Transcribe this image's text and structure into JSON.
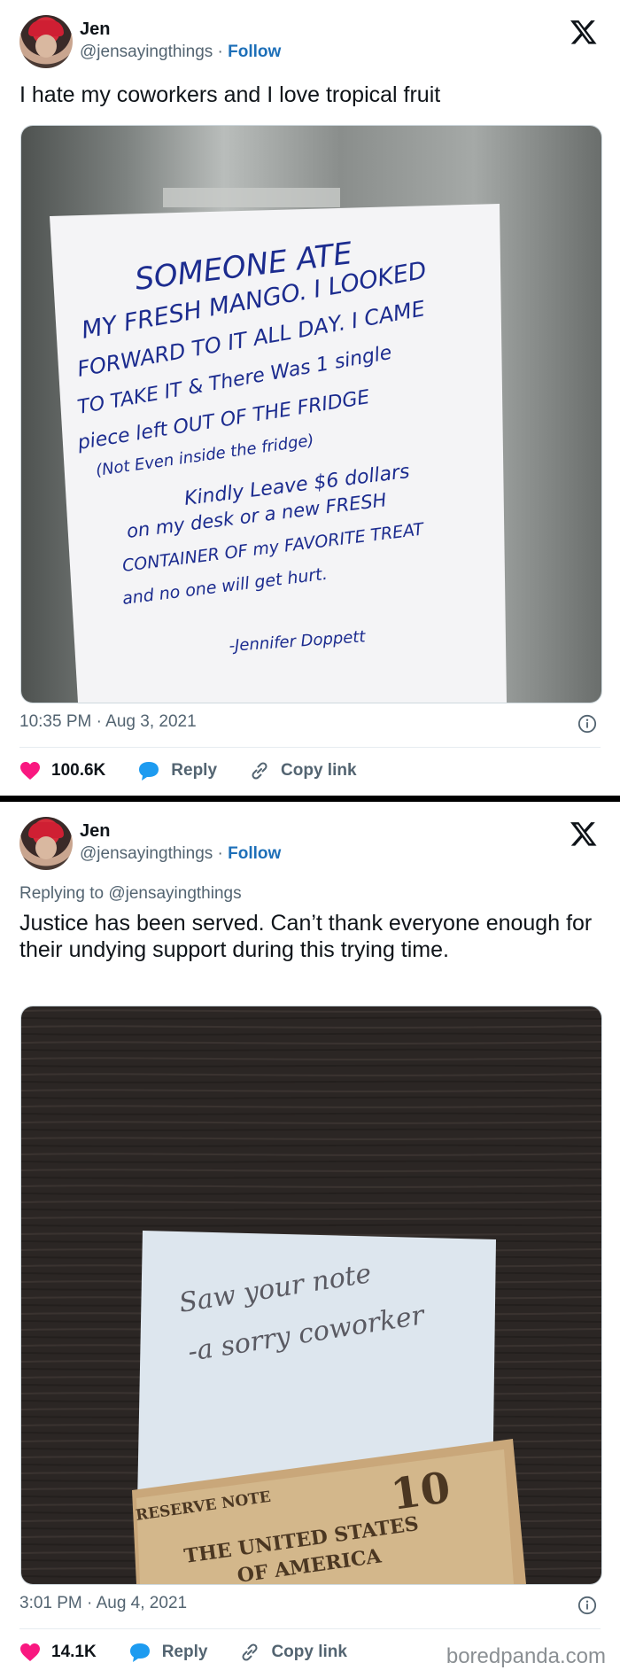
{
  "tweets": [
    {
      "author_name": "Jen",
      "author_handle": "@jensayingthings",
      "separator": "·",
      "follow_label": "Follow",
      "text": "I hate my coworkers and I love tropical fruit",
      "note_lines": [
        "SOMEONE ATE",
        "MY FRESH MANGO. I LOOKED",
        "FORWARD TO IT ALL DAY. I CAME",
        "TO TAKE IT & There Was 1 single",
        "piece left OUT OF THE FRIDGE",
        "(Not Even inside the fridge)",
        "Kindly Leave $6 dollars",
        "on my desk or a new FRESH",
        "CONTAINER OF my FAVORITE TREAT",
        "and no one will get hurt.",
        "-Jennifer Doppett"
      ],
      "timestamp": "10:35 PM · Aug 3, 2021",
      "like_count": "100.6K",
      "reply_label": "Reply",
      "copy_label": "Copy link"
    },
    {
      "author_name": "Jen",
      "author_handle": "@jensayingthings",
      "separator": "·",
      "follow_label": "Follow",
      "reply_to": "Replying to @jensayingthings",
      "text": "Justice has been served. Can’t thank everyone enough for their undying support during this trying time.",
      "note_lines": [
        "Saw your note",
        "-a sorry coworker"
      ],
      "bill_lines": [
        "RESERVE NOTE",
        "THE UNITED STATES",
        "OF AMERICA",
        "10"
      ],
      "timestamp": "3:01 PM · Aug 4, 2021",
      "like_count": "14.1K",
      "reply_label": "Reply",
      "copy_label": "Copy link"
    }
  ],
  "watermark": "boredpanda.com",
  "colors": {
    "like": "#f91880",
    "reply": "#1d9bf0",
    "follow": "#1d6fb8",
    "secondary_text": "#536471",
    "ink_blue": "#1c2c8f"
  }
}
